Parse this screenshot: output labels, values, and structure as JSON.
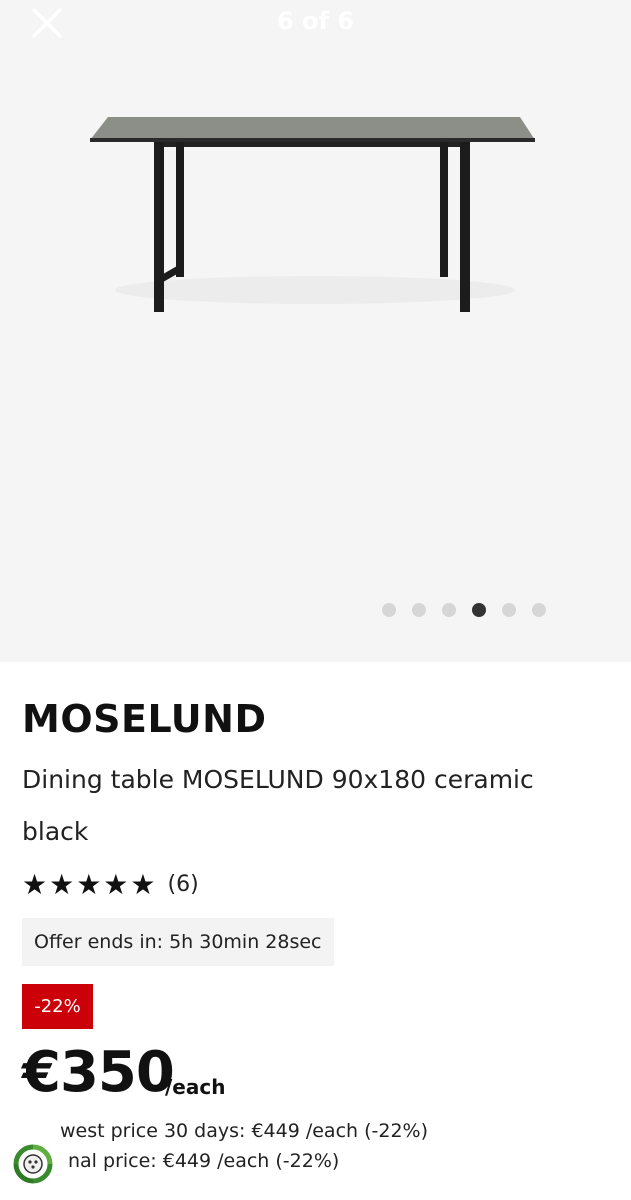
{
  "gallery": {
    "counter": "6 of 6",
    "dots_count": 6,
    "active_dot_index": 3
  },
  "product": {
    "name": "MOSELUND",
    "description": "Dining table MOSELUND 90x180 ceramic black",
    "rating_stars": "★★★★★",
    "rating_value": 5,
    "review_count": "(6)",
    "offer_text": "Offer ends in: 5h 30min 28sec",
    "discount_badge": "-22%",
    "price": "€350",
    "price_unit": "/each",
    "lowest_price_text": "west price 30 days: €449 /each (-22%)",
    "original_price_text": "nal price: €449 /each (-22%)"
  },
  "colors": {
    "discount_red": "#cc0008",
    "gallery_bg": "#f5f5f5",
    "eco_green": "#3a8a2e"
  },
  "icons": {
    "close": "close-icon",
    "eco": "eco-badge-icon"
  }
}
